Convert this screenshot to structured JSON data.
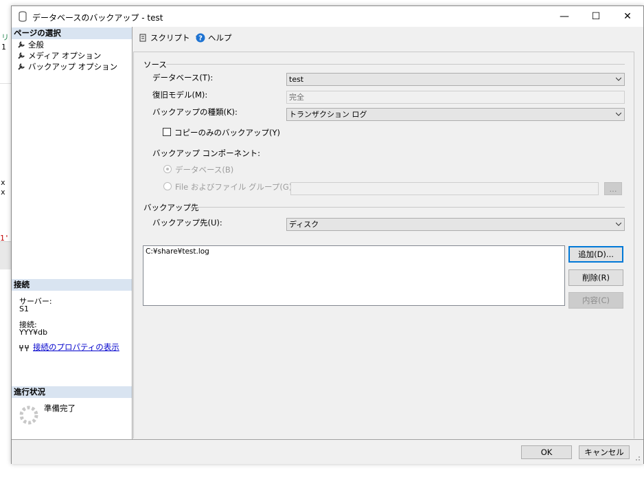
{
  "background": {
    "fragments": [
      "リ",
      "1",
      "x",
      "x",
      "1'"
    ]
  },
  "window": {
    "title": "データベースのバックアップ - test",
    "controls": {
      "minimize": "—",
      "maximize": "☐",
      "close": "✕"
    }
  },
  "left_pane": {
    "page_select_header": "ページの選択",
    "pages": [
      {
        "label": "全般"
      },
      {
        "label": "メディア オプション"
      },
      {
        "label": "バックアップ オプション"
      }
    ],
    "connection_header": "接続",
    "server_label": "サーバー:",
    "server_value": "S1",
    "connection_label": "接続:",
    "connection_value": "YYY¥db",
    "connection_props_link": "接続のプロパティの表示",
    "progress_header": "進行状況",
    "progress_status": "準備完了"
  },
  "toolbar": {
    "script_label": "スクリプト",
    "help_label": "ヘルプ"
  },
  "source": {
    "group_title": "ソース",
    "database_label": "データベース(T):",
    "database_value": "test",
    "recovery_label": "復旧モデル(M):",
    "recovery_value": "完全",
    "backup_type_label": "バックアップの種類(K):",
    "backup_type_value": "トランザクション ログ",
    "copy_only_label": "コピーのみのバックアップ(Y)",
    "copy_only_checked": false,
    "component_label": "バックアップ コンポーネント:",
    "radio_database_label": "データベース(B)",
    "radio_files_label": "File およびファイル グループ(G):",
    "browse_label": "..."
  },
  "destination": {
    "group_title": "バックアップ先",
    "dest_label": "バックアップ先(U):",
    "dest_value": "ディスク",
    "paths": [
      "C:¥share¥test.log"
    ],
    "add_button": "追加(D)...",
    "remove_button": "削除(R)",
    "contents_button": "内容(C)"
  },
  "footer": {
    "ok_button": "OK",
    "cancel_button": "キャンセル"
  },
  "colors": {
    "section_header_bg": "#d9e4f1",
    "link": "#0000cc",
    "accent_border": "#0078d7"
  }
}
